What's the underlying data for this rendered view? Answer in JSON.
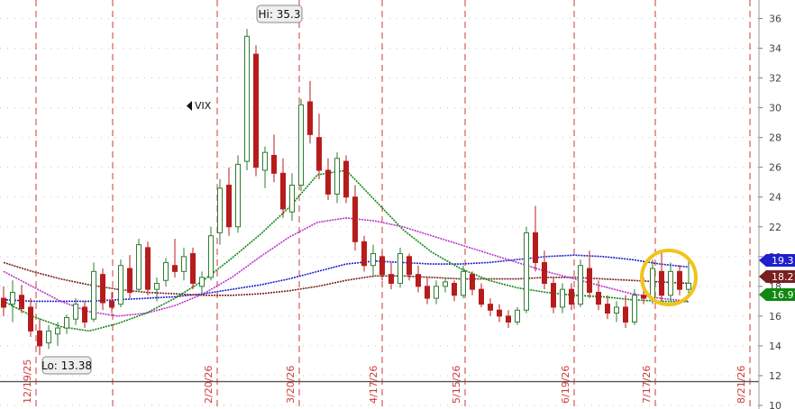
{
  "chart_data": {
    "type": "candlestick",
    "symbol": "VIX",
    "ylim": [
      10,
      37
    ],
    "yticks": [
      10,
      12,
      14,
      16,
      18,
      20,
      22,
      24,
      26,
      28,
      30,
      32,
      34,
      36
    ],
    "date_labels": [
      "12/19/25",
      "2/20/26",
      "3/20/26",
      "4/17/26",
      "5/15/26",
      "6/19/26",
      "7/17/26",
      "8/21/26"
    ],
    "annotations": {
      "high": "Hi: 35.3",
      "low": "Lo: 13.38",
      "symbol": "VIX"
    },
    "reference_line": 11.6,
    "last_values": [
      {
        "value": "19.3",
        "color": "#1f1fcc"
      },
      {
        "value": "18.21",
        "color": "#7a1f1f"
      },
      {
        "value": "16.97",
        "color": "#118811"
      }
    ],
    "moving_averages": [
      {
        "color": "#1f1fcc",
        "values": [
          17.1,
          17.0,
          17.0,
          17.0,
          17.1,
          17.2,
          17.3,
          17.5,
          17.8,
          18.1,
          18.5,
          19.0,
          19.5,
          19.7,
          19.6,
          19.5,
          19.5,
          19.6,
          19.8,
          20.0,
          20.1,
          20.0,
          19.8,
          19.5,
          19.3
        ]
      },
      {
        "color": "#7a1f1f",
        "values": [
          19.6,
          19.0,
          18.5,
          18.1,
          17.8,
          17.6,
          17.5,
          17.4,
          17.4,
          17.5,
          17.7,
          18.0,
          18.4,
          18.7,
          18.7,
          18.6,
          18.5,
          18.5,
          18.5,
          18.6,
          18.6,
          18.5,
          18.4,
          18.3,
          18.2
        ]
      },
      {
        "color": "#bb33cc",
        "values": [
          19.0,
          18.0,
          17.0,
          16.3,
          16.0,
          16.2,
          16.7,
          17.5,
          18.6,
          20.0,
          21.3,
          22.3,
          22.6,
          22.4,
          22.0,
          21.4,
          20.8,
          20.2,
          19.6,
          19.0,
          18.5,
          18.0,
          17.5,
          17.2,
          17.0
        ]
      },
      {
        "color": "#118811",
        "values": [
          17.0,
          16.0,
          15.3,
          15.0,
          15.5,
          16.2,
          17.2,
          18.4,
          19.9,
          21.5,
          23.3,
          25.5,
          25.8,
          23.8,
          21.8,
          20.3,
          19.2,
          18.4,
          17.9,
          17.6,
          17.4,
          17.3,
          17.1,
          17.0,
          16.97
        ]
      }
    ],
    "candles": [
      {
        "o": 17.2,
        "h": 18.0,
        "l": 16.0,
        "c": 16.6
      },
      {
        "o": 16.8,
        "h": 18.4,
        "l": 15.6,
        "c": 17.6
      },
      {
        "o": 17.4,
        "h": 18.1,
        "l": 16.2,
        "c": 16.5
      },
      {
        "o": 16.6,
        "h": 17.2,
        "l": 14.6,
        "c": 15.0
      },
      {
        "o": 15.0,
        "h": 15.8,
        "l": 13.38,
        "c": 14.0
      },
      {
        "o": 14.2,
        "h": 15.4,
        "l": 13.8,
        "c": 15.0
      },
      {
        "o": 14.8,
        "h": 15.6,
        "l": 14.0,
        "c": 15.2
      },
      {
        "o": 15.2,
        "h": 16.1,
        "l": 14.8,
        "c": 15.9
      },
      {
        "o": 15.8,
        "h": 17.2,
        "l": 15.4,
        "c": 16.8
      },
      {
        "o": 16.6,
        "h": 17.0,
        "l": 15.2,
        "c": 15.6
      },
      {
        "o": 15.8,
        "h": 19.6,
        "l": 15.6,
        "c": 19.0
      },
      {
        "o": 18.8,
        "h": 19.2,
        "l": 16.4,
        "c": 16.9
      },
      {
        "o": 17.0,
        "h": 17.6,
        "l": 16.2,
        "c": 16.6
      },
      {
        "o": 16.8,
        "h": 19.8,
        "l": 16.6,
        "c": 19.4
      },
      {
        "o": 19.2,
        "h": 20.1,
        "l": 17.2,
        "c": 17.6
      },
      {
        "o": 17.8,
        "h": 21.2,
        "l": 17.6,
        "c": 20.8
      },
      {
        "o": 20.6,
        "h": 21.0,
        "l": 17.4,
        "c": 17.8
      },
      {
        "o": 17.8,
        "h": 18.6,
        "l": 17.0,
        "c": 18.2
      },
      {
        "o": 18.4,
        "h": 19.9,
        "l": 18.0,
        "c": 19.6
      },
      {
        "o": 19.4,
        "h": 21.2,
        "l": 18.6,
        "c": 19.0
      },
      {
        "o": 19.0,
        "h": 20.6,
        "l": 18.4,
        "c": 20.0
      },
      {
        "o": 20.2,
        "h": 20.6,
        "l": 17.8,
        "c": 18.2
      },
      {
        "o": 18.0,
        "h": 19.0,
        "l": 17.4,
        "c": 18.6
      },
      {
        "o": 18.6,
        "h": 22.0,
        "l": 18.4,
        "c": 21.4
      },
      {
        "o": 21.6,
        "h": 25.2,
        "l": 20.8,
        "c": 24.6
      },
      {
        "o": 24.8,
        "h": 26.0,
        "l": 21.4,
        "c": 22.0
      },
      {
        "o": 22.0,
        "h": 26.8,
        "l": 21.6,
        "c": 26.2
      },
      {
        "o": 26.4,
        "h": 35.3,
        "l": 25.8,
        "c": 34.8
      },
      {
        "o": 33.6,
        "h": 34.2,
        "l": 25.4,
        "c": 26.0
      },
      {
        "o": 25.8,
        "h": 27.4,
        "l": 24.6,
        "c": 27.0
      },
      {
        "o": 26.8,
        "h": 28.2,
        "l": 25.0,
        "c": 25.6
      },
      {
        "o": 25.6,
        "h": 26.6,
        "l": 22.6,
        "c": 23.2
      },
      {
        "o": 23.0,
        "h": 25.6,
        "l": 22.4,
        "c": 24.8
      },
      {
        "o": 24.8,
        "h": 30.6,
        "l": 24.4,
        "c": 30.2
      },
      {
        "o": 30.4,
        "h": 31.8,
        "l": 27.6,
        "c": 28.2
      },
      {
        "o": 28.0,
        "h": 29.6,
        "l": 25.2,
        "c": 25.8
      },
      {
        "o": 25.8,
        "h": 26.6,
        "l": 23.8,
        "c": 24.2
      },
      {
        "o": 24.2,
        "h": 27.0,
        "l": 23.6,
        "c": 26.6
      },
      {
        "o": 26.4,
        "h": 26.8,
        "l": 23.6,
        "c": 24.0
      },
      {
        "o": 24.0,
        "h": 24.8,
        "l": 20.4,
        "c": 21.0
      },
      {
        "o": 21.0,
        "h": 21.4,
        "l": 19.0,
        "c": 19.4
      },
      {
        "o": 19.4,
        "h": 20.8,
        "l": 18.6,
        "c": 20.2
      },
      {
        "o": 20.0,
        "h": 20.4,
        "l": 18.4,
        "c": 18.8
      },
      {
        "o": 18.8,
        "h": 19.6,
        "l": 17.8,
        "c": 18.2
      },
      {
        "o": 18.2,
        "h": 20.6,
        "l": 17.9,
        "c": 20.2
      },
      {
        "o": 20.0,
        "h": 20.2,
        "l": 18.4,
        "c": 18.8
      },
      {
        "o": 18.8,
        "h": 19.4,
        "l": 17.6,
        "c": 18.0
      },
      {
        "o": 18.0,
        "h": 18.6,
        "l": 16.8,
        "c": 17.2
      },
      {
        "o": 17.2,
        "h": 18.4,
        "l": 16.8,
        "c": 18.0
      },
      {
        "o": 18.0,
        "h": 18.6,
        "l": 17.6,
        "c": 18.3
      },
      {
        "o": 18.2,
        "h": 18.4,
        "l": 17.0,
        "c": 17.4
      },
      {
        "o": 17.4,
        "h": 19.4,
        "l": 17.2,
        "c": 19.0
      },
      {
        "o": 18.8,
        "h": 19.0,
        "l": 17.4,
        "c": 17.8
      },
      {
        "o": 17.8,
        "h": 18.2,
        "l": 16.6,
        "c": 16.8
      },
      {
        "o": 16.8,
        "h": 17.2,
        "l": 16.0,
        "c": 16.4
      },
      {
        "o": 16.4,
        "h": 16.8,
        "l": 15.6,
        "c": 16.0
      },
      {
        "o": 16.0,
        "h": 16.4,
        "l": 15.2,
        "c": 15.6
      },
      {
        "o": 15.6,
        "h": 16.6,
        "l": 15.4,
        "c": 16.4
      },
      {
        "o": 16.4,
        "h": 22.0,
        "l": 16.2,
        "c": 21.6
      },
      {
        "o": 21.6,
        "h": 23.4,
        "l": 19.0,
        "c": 19.6
      },
      {
        "o": 19.6,
        "h": 20.4,
        "l": 17.8,
        "c": 18.2
      },
      {
        "o": 18.2,
        "h": 18.6,
        "l": 16.2,
        "c": 16.6
      },
      {
        "o": 16.6,
        "h": 18.2,
        "l": 16.2,
        "c": 17.8
      },
      {
        "o": 17.8,
        "h": 18.2,
        "l": 16.4,
        "c": 16.8
      },
      {
        "o": 16.8,
        "h": 19.8,
        "l": 16.6,
        "c": 19.4
      },
      {
        "o": 19.2,
        "h": 20.4,
        "l": 17.2,
        "c": 17.6
      },
      {
        "o": 17.6,
        "h": 18.4,
        "l": 16.4,
        "c": 16.8
      },
      {
        "o": 16.8,
        "h": 17.4,
        "l": 15.8,
        "c": 16.2
      },
      {
        "o": 16.2,
        "h": 17.0,
        "l": 15.6,
        "c": 16.6
      },
      {
        "o": 16.6,
        "h": 17.4,
        "l": 15.2,
        "c": 15.6
      },
      {
        "o": 15.6,
        "h": 17.8,
        "l": 15.4,
        "c": 17.4
      },
      {
        "o": 17.4,
        "h": 18.6,
        "l": 16.8,
        "c": 17.2
      },
      {
        "o": 17.2,
        "h": 19.8,
        "l": 16.8,
        "c": 19.2
      },
      {
        "o": 19.0,
        "h": 20.4,
        "l": 17.0,
        "c": 17.4
      },
      {
        "o": 17.4,
        "h": 19.6,
        "l": 17.0,
        "c": 19.0
      },
      {
        "o": 19.0,
        "h": 19.4,
        "l": 17.4,
        "c": 17.8
      },
      {
        "o": 17.8,
        "h": 19.8,
        "l": 17.4,
        "c": 18.21
      }
    ],
    "highlight": {
      "candle_index": 74,
      "value": 18.6
    }
  }
}
